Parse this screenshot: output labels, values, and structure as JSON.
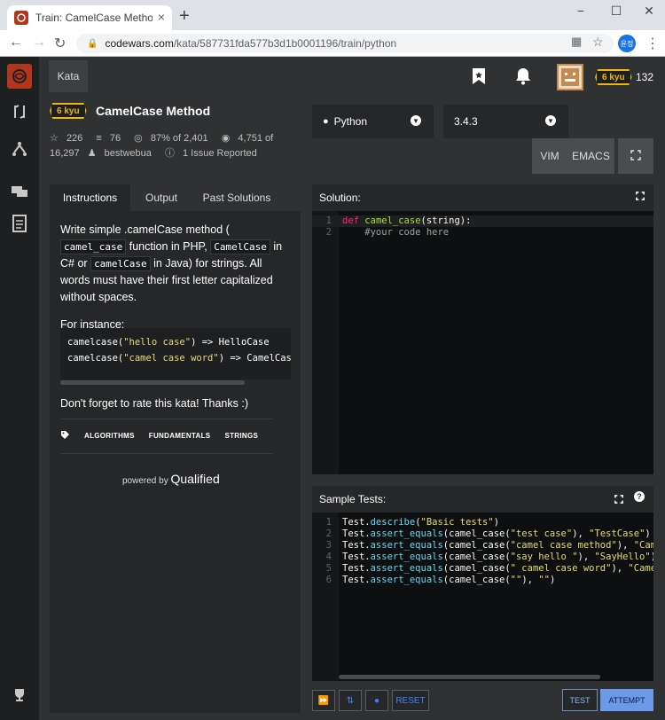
{
  "browser": {
    "tab_title": "Train: CamelCase Method | Codewars",
    "url_domain": "codewars.com",
    "url_path": "/kata/587731fda577b3d1b0001196/train/python",
    "profile_initials": "윤정",
    "new_tab": "+",
    "close": "×",
    "window_controls": [
      "−",
      "☐",
      "✕"
    ]
  },
  "topbar": {
    "kata_tab": "Kata",
    "user_rank": "6 kyu",
    "honor": "132"
  },
  "kata": {
    "rank": "6 kyu",
    "title": "CamelCase Method",
    "stats": {
      "stars": "226",
      "collections": "76",
      "satisfaction": "87% of 2,401",
      "completed": "4,751 of",
      "attempts": "16,297",
      "author": "bestwebua",
      "issues": "1 Issue Reported"
    }
  },
  "language": {
    "selected": "Python",
    "version": "3.4.3",
    "modes": [
      "VIM",
      "EMACS"
    ]
  },
  "left_tabs": [
    "Instructions",
    "Output",
    "Past Solutions"
  ],
  "description": {
    "p1_a": "Write simple .camelCase method (",
    "code1": "camel_case",
    "p1_b": "function in PHP,",
    "code2": "CamelCase",
    "p1_c": "in C# or",
    "code3": "camelCase",
    "p1_d": "in Java) for strings. All words must have their first letter capitalized without spaces.",
    "p2": "For instance:",
    "example_lines": [
      {
        "pre": "camelcase(",
        "str": "\"hello case\"",
        "post": ") => HelloCase"
      },
      {
        "pre": "camelcase(",
        "str": "\"camel case word\"",
        "post": ") => CamelCaseWord"
      }
    ],
    "rate": "Don't forget to rate this kata! Thanks :)",
    "tags": [
      "ALGORITHMS",
      "FUNDAMENTALS",
      "STRINGS"
    ],
    "powered_by": "powered by",
    "qualified": "Qualified"
  },
  "solution": {
    "header": "Solution:",
    "line1_kw": "def ",
    "line1_fn": "camel_case",
    "line1_rest": "(string):",
    "line2": "    #your code here"
  },
  "tests": {
    "header": "Sample Tests:",
    "lines": [
      {
        "n": "1",
        "a": "Test.",
        "b": "describe",
        "c": "(",
        "s": "\"Basic tests\"",
        "d": ")"
      },
      {
        "n": "2",
        "a": "Test.",
        "b": "assert_equals",
        "c": "(camel_case(",
        "s": "\"test case\"",
        "d": "), ",
        "s2": "\"TestCase\"",
        "e": ")"
      },
      {
        "n": "3",
        "a": "Test.",
        "b": "assert_equals",
        "c": "(camel_case(",
        "s": "\"camel case method\"",
        "d": "), ",
        "s2": "\"CamelCaseMethod\"",
        "e": ")"
      },
      {
        "n": "4",
        "a": "Test.",
        "b": "assert_equals",
        "c": "(camel_case(",
        "s": "\"say hello \"",
        "d": "), ",
        "s2": "\"SayHello\"",
        "e": ")"
      },
      {
        "n": "5",
        "a": "Test.",
        "b": "assert_equals",
        "c": "(camel_case(",
        "s": "\" camel case word\"",
        "d": "), ",
        "s2": "\"CamelCaseWord\"",
        "e": ")"
      },
      {
        "n": "6",
        "a": "Test.",
        "b": "assert_equals",
        "c": "(camel_case(",
        "s": "\"\"",
        "d": "), ",
        "s2": "\"\"",
        "e": ")"
      }
    ]
  },
  "bottom": {
    "reset": "RESET",
    "test": "TEST",
    "attempt": "ATTEMPT"
  }
}
